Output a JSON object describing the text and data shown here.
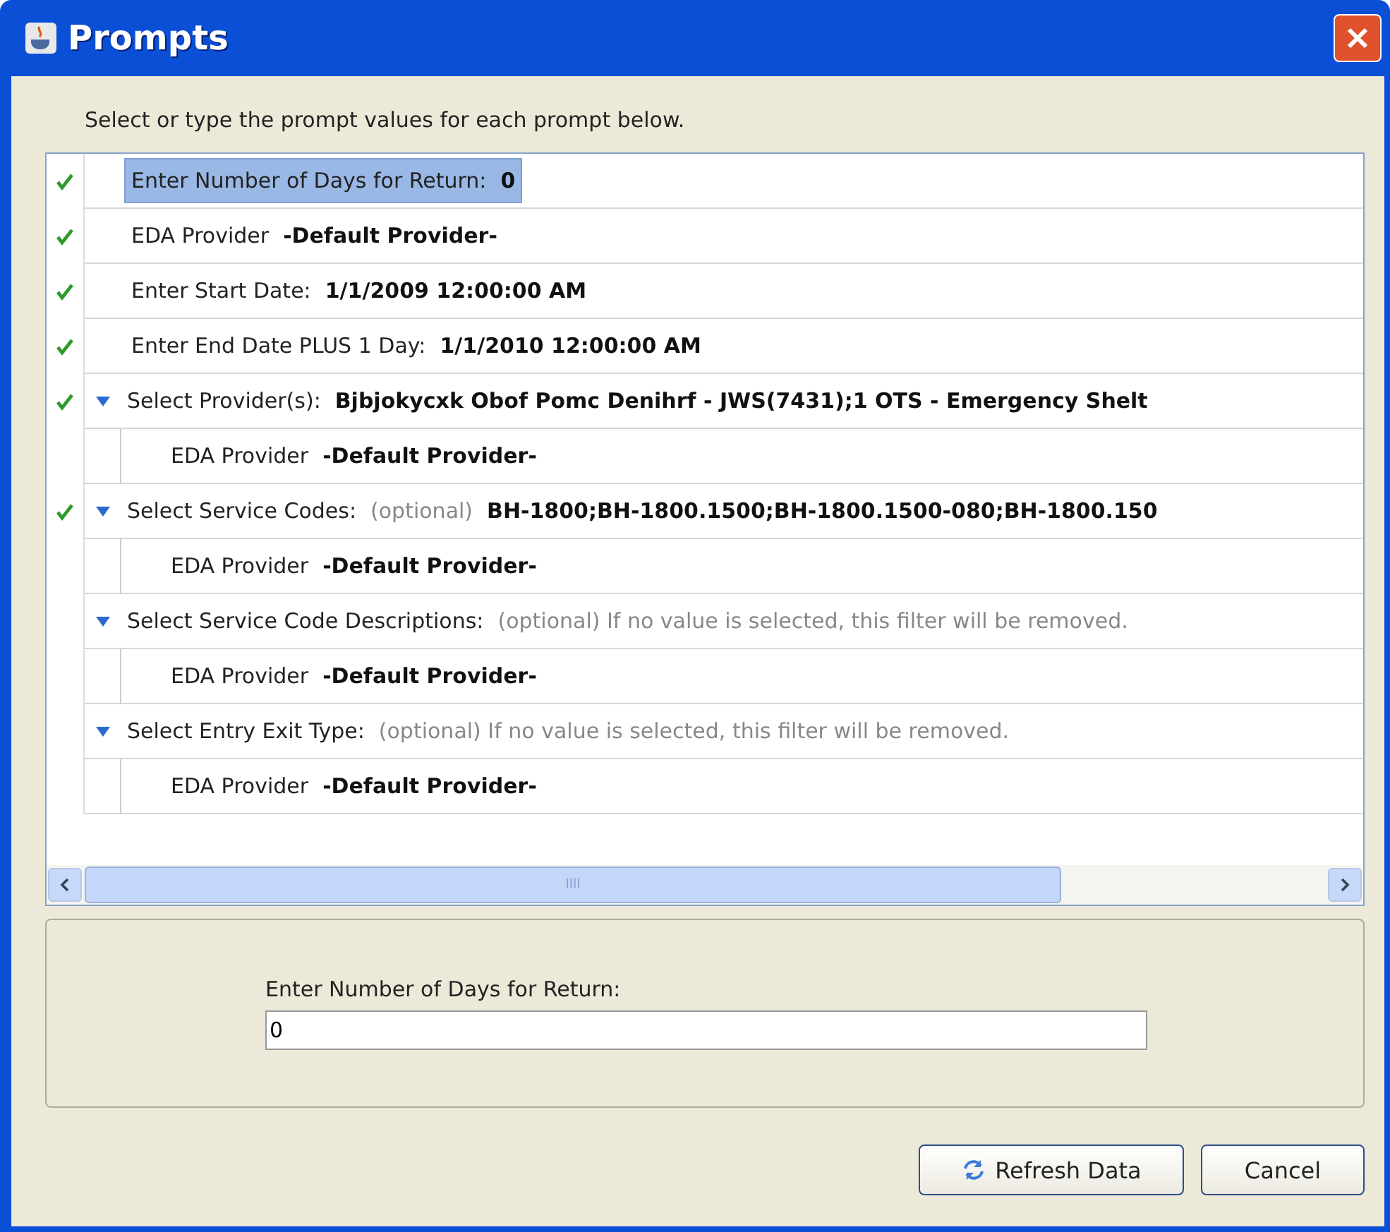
{
  "window": {
    "title": "Prompts"
  },
  "instruction": "Select or type the prompt values for each prompt below.",
  "prompts": [
    {
      "label": "Enter Number of Days for Return:",
      "value": "0",
      "checked": true,
      "selected": true
    },
    {
      "label": "EDA Provider",
      "value": "-Default Provider-",
      "checked": true,
      "selected": false
    },
    {
      "label": "Enter Start Date:",
      "value": "1/1/2009 12:00:00 AM",
      "checked": true,
      "selected": false
    },
    {
      "label": "Enter End Date PLUS 1 Day:",
      "value": "1/1/2010 12:00:00 AM",
      "checked": true,
      "selected": false
    },
    {
      "label": "Select Provider(s):",
      "value": "Bjbjokycxk Obof Pomc Denihrf - JWS(7431);1 OTS - Emergency Shelt",
      "checked": true,
      "selected": false,
      "expanded": true,
      "children": [
        {
          "label": "EDA Provider",
          "value": "-Default Provider-"
        }
      ]
    },
    {
      "label": "Select Service Codes:",
      "optional": "(optional)",
      "value": "BH-1800;BH-1800.1500;BH-1800.1500-080;BH-1800.150",
      "checked": true,
      "selected": false,
      "expanded": true,
      "children": [
        {
          "label": "EDA Provider",
          "value": "-Default Provider-"
        }
      ]
    },
    {
      "label": "Select Service Code Descriptions:",
      "optional": "(optional) If no value is selected, this filter will be removed.",
      "checked": false,
      "selected": false,
      "expanded": true,
      "children": [
        {
          "label": "EDA Provider",
          "value": "-Default Provider-"
        }
      ]
    },
    {
      "label": "Select Entry Exit Type:",
      "optional": "(optional) If no value is selected, this filter will be removed.",
      "checked": false,
      "selected": false,
      "expanded": true,
      "children": [
        {
          "label": "EDA Provider",
          "value": "-Default Provider-"
        }
      ]
    }
  ],
  "scrollbar_grip": "IIII",
  "editor": {
    "label": "Enter Number of Days for Return:",
    "value": "0"
  },
  "buttons": [
    "Refresh Data",
    "Cancel"
  ]
}
